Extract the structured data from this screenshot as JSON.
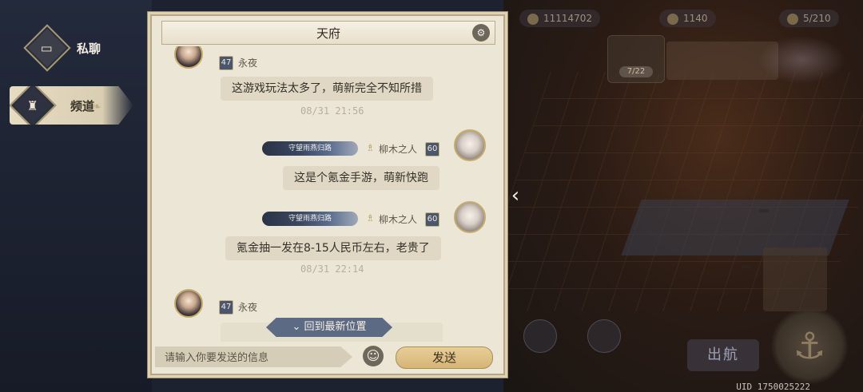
{
  "sidebar": {
    "tabs": [
      {
        "label": "私聊",
        "icon": "chat-bubble-icon"
      },
      {
        "label": "频道",
        "icon": "chess-rook-icon"
      }
    ]
  },
  "chat": {
    "title": "天府",
    "messages": [
      {
        "sender": "永夜",
        "level": "47",
        "side": "left",
        "text": "这游戏玩法太多了，萌新完全不知所措",
        "time": "08/31 21:56"
      },
      {
        "sender": "柳木之人",
        "level": "60",
        "side": "right",
        "title_badge": "守望雨燕归路",
        "text": "这是个氪金手游，萌新快跑"
      },
      {
        "sender": "柳木之人",
        "level": "60",
        "side": "right",
        "title_badge": "守望雨燕归路",
        "text": "氪金抽一发在8-15人民币左右，老贵了",
        "time": "08/31 22:14"
      },
      {
        "sender": "永夜",
        "level": "47",
        "side": "left"
      }
    ],
    "newest_button": "回到最新位置",
    "input_placeholder": "请输入你要发送的信息",
    "send_label": "发送"
  },
  "hud": {
    "uid": "UID 1750025222",
    "sail_label": "出航",
    "res1": "11114702",
    "res2": "1140",
    "res3": "5/210",
    "box_level": "7/22"
  },
  "colors": {
    "panel_bg": "#ece6d7",
    "accent_gold": "#c6ac6a",
    "level_badge": "#4a5670",
    "newest_btn": "#5c6a83",
    "send_btn": "#d6b575"
  }
}
